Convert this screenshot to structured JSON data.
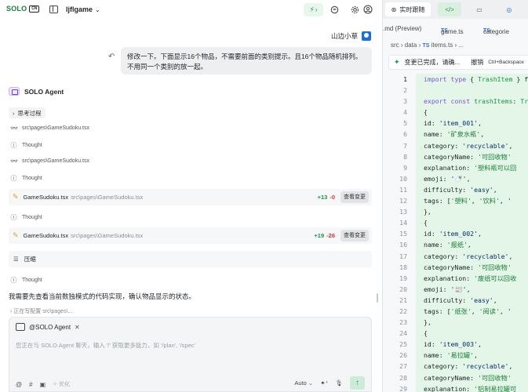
{
  "topbar": {
    "brand": "SOLO",
    "brand_box": "CN",
    "project": "ljflgame",
    "bolt_arrow": "›"
  },
  "chat": {
    "user_name": "山边小草",
    "user_message": "修改一下。下面显示16个物品，不需要前面的类别提示。且16个物品随机排列。不用同一个类别的放一起。",
    "agent_name": "SOLO Agent",
    "thinking_label": "思考过程",
    "read1": "src\\pages\\GameSudoku.tsx",
    "thought1": "Thought",
    "read2": "src\\pages\\GameSudoku.tsx",
    "thought2": "Thought",
    "edit1": {
      "file": "GameSudoku.tsx",
      "path": "src\\pages\\GameSudoku.tsx",
      "added": "+13",
      "removed": "-0",
      "view": "查看变更"
    },
    "thought3": "Thought",
    "edit2": {
      "file": "GameSudoku.tsx",
      "path": "src\\pages\\GameSudoku.tsx",
      "added": "+19",
      "removed": "-26",
      "view": "查看变更"
    },
    "compress_label": "压缩",
    "thought4": "Thought",
    "plain_text": "我需要先查看当前数独模式的代码实现，确认物品显示的状态。",
    "cutoff_text": "› 正在写配置 src\\pages\\..."
  },
  "composer": {
    "mention": "@SOLO Agent",
    "placeholder": "您正在与 SOLO Agent 聊天，输入 '/' 获取更多能力，如 '/plan', '/spec'",
    "optimize": "优化",
    "model": "Auto"
  },
  "right_panel": {
    "tab_realtime": "实时跟随",
    "file_tabs": [
      ".md (Preview)",
      "game.ts",
      "categorie"
    ],
    "ts_badge": "TS",
    "breadcrumb": [
      "src",
      "data",
      "items.ts",
      "..."
    ],
    "change_text": "变更已完成，请确...",
    "undo": "撤销",
    "shortcut": "Ctrl+Backspace"
  },
  "code_lines": [
    {
      "n": "1",
      "t": "import type { TrashItem } f"
    },
    {
      "n": "2",
      "t": ""
    },
    {
      "n": "3",
      "t": "export const trashItems: Tr"
    },
    {
      "n": "4",
      "t": "  {"
    },
    {
      "n": "5",
      "t": "    id: 'item_001',"
    },
    {
      "n": "6",
      "t": "    name: '矿泉水瓶',"
    },
    {
      "n": "7",
      "t": "    category: 'recyclable',"
    },
    {
      "n": "8",
      "t": "    categoryName: '可回收物'"
    },
    {
      "n": "9",
      "t": "    explanation: '塑料瓶可以回"
    },
    {
      "n": "10",
      "t": "    emoji: '🍼',"
    },
    {
      "n": "11",
      "t": "    difficulty: 'easy',"
    },
    {
      "n": "12",
      "t": "    tags: ['塑料', '饮料', '"
    },
    {
      "n": "13",
      "t": "  },"
    },
    {
      "n": "14",
      "t": "  {"
    },
    {
      "n": "15",
      "t": "    id: 'item_002',"
    },
    {
      "n": "16",
      "t": "    name: '报纸',"
    },
    {
      "n": "17",
      "t": "    category: 'recyclable',"
    },
    {
      "n": "18",
      "t": "    categoryName: '可回收物'"
    },
    {
      "n": "19",
      "t": "    explanation: '废纸可以回收"
    },
    {
      "n": "20",
      "t": "    emoji: '📰',"
    },
    {
      "n": "21",
      "t": "    difficulty: 'easy',"
    },
    {
      "n": "22",
      "t": "    tags: ['纸张', '阅读', '"
    },
    {
      "n": "23",
      "t": "  },"
    },
    {
      "n": "24",
      "t": "  {"
    },
    {
      "n": "25",
      "t": "    id: 'item_003',"
    },
    {
      "n": "26",
      "t": "    name: '易拉罐',"
    },
    {
      "n": "27",
      "t": "    category: 'recyclable',"
    },
    {
      "n": "28",
      "t": "    categoryName: '可回收物'"
    },
    {
      "n": "29",
      "t": "    explanation: '铝制易拉罐可"
    }
  ]
}
